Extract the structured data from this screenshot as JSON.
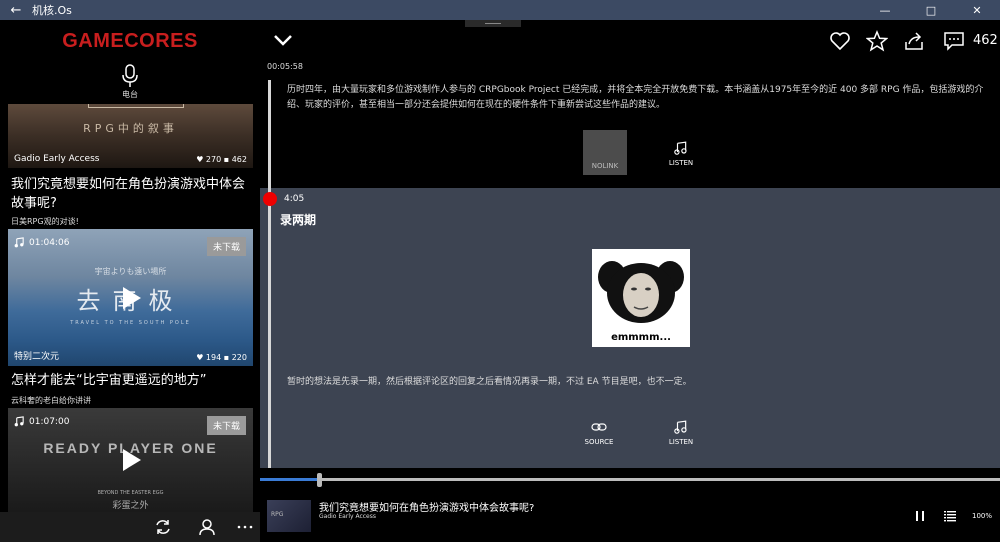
{
  "window": {
    "title": "机核.Os",
    "back_glyph": "←",
    "minimize_glyph": "—",
    "maximize_glyph": "□",
    "close_glyph": "✕"
  },
  "sidebar": {
    "logo": "GAMECORES",
    "radio_label": "电台",
    "cards": [
      {
        "banner_text": "RPG中的叙事",
        "program": "Gadio Early Access",
        "likes": "270",
        "comments": "462",
        "title": "我们究竟想要如何在角色扮演游戏中体会故事呢?",
        "subtitle": "日美RPG观的对谈!"
      },
      {
        "duration": "01:04:06",
        "badge": "未下载",
        "banner_small": "宇宙よりも遠い場所",
        "banner_big": "去南极",
        "banner_eng": "TRAVEL TO THE SOUTH POLE",
        "program": "特别二次元",
        "likes": "194",
        "comments": "220",
        "title": "怎样才能去“比宇宙更遥远的地方”",
        "subtitle": "云科奢的老白给你讲讲"
      },
      {
        "duration": "01:07:00",
        "badge": "未下载",
        "banner_big": "READY PLAYER ONE",
        "banner_eng": "BEYOND THE EASTER EGG",
        "banner_cn": "彩蛋之外"
      }
    ]
  },
  "main": {
    "comment_count": "462",
    "timeline": [
      {
        "time": "00:05:58",
        "text": "历时四年，由大量玩家和多位游戏制作人参与的 CRPGbook Project 已经完成，并将全本完全开放免费下载。本书涵盖从1975年至今的近 400 多部 RPG 作品，包括游戏的介绍、玩家的评价，甚至相当一部分还会提供如何在现在的硬件条件下重新尝试这些作品的建议。",
        "link_label": "NOLINK",
        "listen_label": "LISTEN"
      },
      {
        "time": "4:05",
        "title": "录两期",
        "image_caption": "emmmm...",
        "text": "暂时的想法是先录一期，然后根据评论区的回复之后看情况再录一期，不过 EA 节目是吧，也不一定。",
        "source_label": "SOURCE",
        "listen_label": "LISTEN"
      }
    ],
    "player": {
      "progress": 0.08,
      "title": "我们究竟想要如何在角色扮演游戏中体会故事呢?",
      "artist": "Gadio Early Access",
      "volume": "100%"
    }
  },
  "colors": {
    "brand_red": "#c81e1e",
    "titlebar": "#3c4a63",
    "highlight_section": "#3d4452",
    "progress": "#3a7bd5",
    "marker": "#e00000"
  }
}
